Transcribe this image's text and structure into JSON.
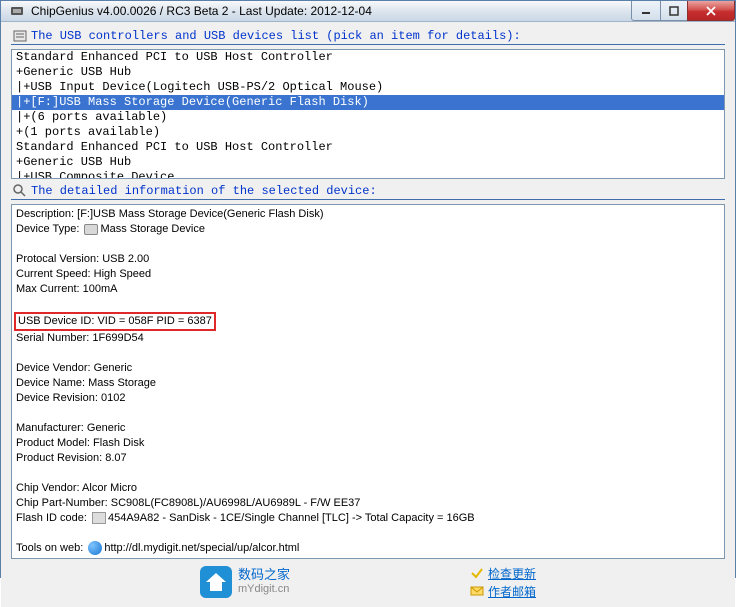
{
  "title": "ChipGenius v4.00.0026 / RC3 Beta 2 - Last Update: 2012-12-04",
  "list_header": "The USB controllers and USB devices list (pick an item for details):",
  "list_items": [
    {
      "text": "Standard Enhanced PCI to USB Host Controller",
      "selected": false
    },
    {
      "text": "+Generic USB Hub",
      "selected": false
    },
    {
      "text": "|+USB Input Device(Logitech USB-PS/2 Optical Mouse)",
      "selected": false
    },
    {
      "text": "|+[F:]USB Mass Storage Device(Generic Flash Disk)",
      "selected": true
    },
    {
      "text": "|+(6 ports available)",
      "selected": false
    },
    {
      "text": "+(1 ports available)",
      "selected": false
    },
    {
      "text": "Standard Enhanced PCI to USB Host Controller",
      "selected": false
    },
    {
      "text": "+Generic USB Hub",
      "selected": false
    },
    {
      "text": "|+USB Composite Device",
      "selected": false
    }
  ],
  "detail_header": "The detailed information of the selected device:",
  "details": {
    "description_label": "Description: ",
    "description_value": "[F:]USB Mass Storage Device(Generic Flash Disk)",
    "devtype_label": "Device Type: ",
    "devtype_value": "Mass Storage Device",
    "protocol": "Protocal Version: USB 2.00",
    "speed": "Current Speed: High Speed",
    "maxcurrent": "Max Current: 100mA",
    "deviceid": "USB Device ID: VID = 058F PID = 6387",
    "serial": "Serial Number: 1F699D54",
    "vendor": "Device Vendor: Generic",
    "devname": "Device Name: Mass Storage",
    "revision": "Device Revision: 0102",
    "manufacturer": "Manufacturer: Generic",
    "model": "Product Model: Flash Disk",
    "prodrev": "Product Revision: 8.07",
    "chipvendor": "Chip Vendor: Alcor Micro",
    "chippart": "Chip Part-Number: SC908L(FC8908L)/AU6998L/AU6989L - F/W EE37",
    "flashid_pre": "Flash ID code: ",
    "flashid_val": "454A9A82 - SanDisk - 1CE/Single Channel [TLC] -> Total Capacity = 16GB",
    "tools_label": "Tools on web: ",
    "tools_url": "http://dl.mydigit.net/special/up/alcor.html"
  },
  "footer": {
    "brand_cn": "数码之家",
    "brand_en": "mYdigit.cn",
    "link1": "检查更新",
    "link2": "作者邮箱"
  }
}
